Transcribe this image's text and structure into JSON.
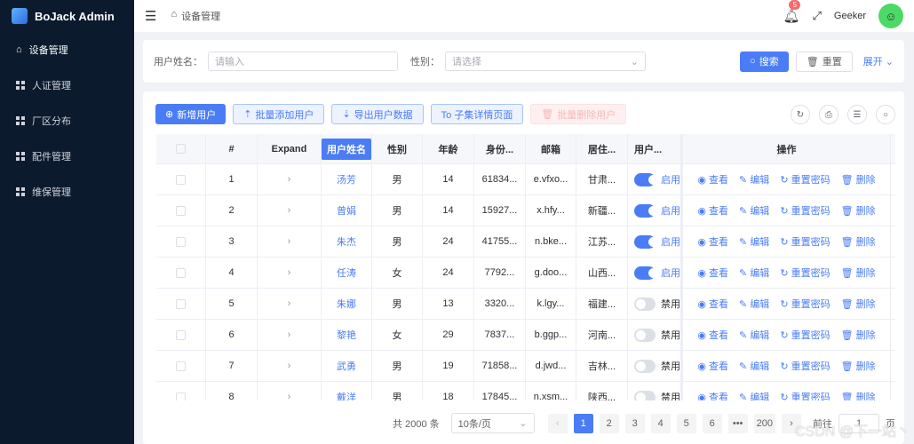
{
  "app": {
    "title": "BoJack Admin"
  },
  "sidebar": {
    "items": [
      {
        "label": "设备管理",
        "icon": "inbox-icon",
        "active": true
      },
      {
        "label": "人证管理",
        "icon": "grid-icon"
      },
      {
        "label": "厂区分布",
        "icon": "grid-icon"
      },
      {
        "label": "配件管理",
        "icon": "grid-icon"
      },
      {
        "label": "维保管理",
        "icon": "grid-icon"
      }
    ]
  },
  "header": {
    "breadcrumb": "设备管理",
    "notifications": "5",
    "username": "Geeker"
  },
  "search": {
    "name_label": "用户姓名：",
    "name_placeholder": "请输入",
    "gender_label": "性别：",
    "gender_placeholder": "请选择",
    "search_label": "搜索",
    "reset_label": "重置",
    "expand_label": "展开"
  },
  "toolbar": {
    "add": "新增用户",
    "batch_add": "批量添加用户",
    "export": "导出用户数据",
    "to_detail": "To 子集详情页面",
    "batch_delete": "批量删除用户"
  },
  "table": {
    "columns": [
      "#",
      "Expand",
      "用户姓名",
      "性别",
      "年龄",
      "身份...",
      "邮箱",
      "居住...",
      "用户...",
      "操作"
    ],
    "rows": [
      {
        "idx": "1",
        "name": "汤芳",
        "gender": "男",
        "age": "14",
        "id": "61834...",
        "email": "e.vfxo...",
        "addr": "甘肃...",
        "enabled": true,
        "status": "启用"
      },
      {
        "idx": "2",
        "name": "曾娟",
        "gender": "男",
        "age": "14",
        "id": "15927...",
        "email": "x.hfy...",
        "addr": "新疆...",
        "enabled": true,
        "status": "启用"
      },
      {
        "idx": "3",
        "name": "朱杰",
        "gender": "男",
        "age": "24",
        "id": "41755...",
        "email": "n.bke...",
        "addr": "江苏...",
        "enabled": true,
        "status": "启用"
      },
      {
        "idx": "4",
        "name": "任涛",
        "gender": "女",
        "age": "24",
        "id": "7792...",
        "email": "g.doo...",
        "addr": "山西...",
        "enabled": true,
        "status": "启用"
      },
      {
        "idx": "5",
        "name": "朱娜",
        "gender": "男",
        "age": "13",
        "id": "3320...",
        "email": "k.lgy...",
        "addr": "福建...",
        "enabled": false,
        "status": "禁用"
      },
      {
        "idx": "6",
        "name": "黎艳",
        "gender": "女",
        "age": "29",
        "id": "7837...",
        "email": "b.ggp...",
        "addr": "河南...",
        "enabled": false,
        "status": "禁用"
      },
      {
        "idx": "7",
        "name": "武勇",
        "gender": "男",
        "age": "19",
        "id": "71858...",
        "email": "d.jwd...",
        "addr": "吉林...",
        "enabled": false,
        "status": "禁用"
      },
      {
        "idx": "8",
        "name": "戴洋",
        "gender": "男",
        "age": "18",
        "id": "17845...",
        "email": "n.xsm...",
        "addr": "陕西...",
        "enabled": false,
        "status": "禁用"
      }
    ],
    "actions": [
      "查看",
      "编辑",
      "重置密码",
      "删除"
    ]
  },
  "pagination": {
    "total": "共 2000 条",
    "page_size": "10条/页",
    "pages": [
      "1",
      "2",
      "3",
      "4",
      "5",
      "6",
      "•••",
      "200"
    ],
    "current": "1",
    "goto_label": "前往",
    "goto_value": "1",
    "page_suffix": "页"
  },
  "watermark": "CSDN @下一站丶",
  "colors": {
    "primary": "#4a7cf6",
    "sidebar": "#0b1a2c"
  }
}
